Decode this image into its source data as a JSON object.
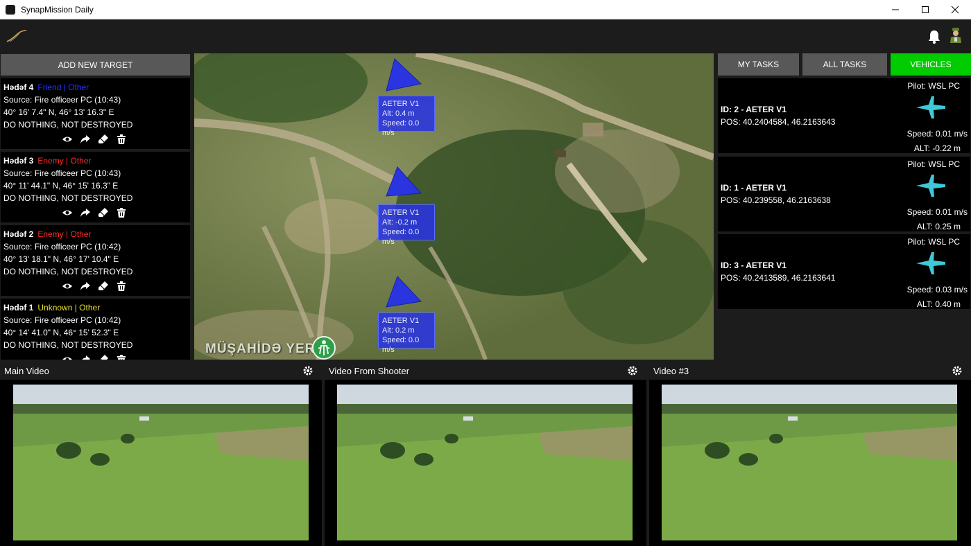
{
  "window": {
    "title": "SynapMission Daily"
  },
  "left_panel": {
    "add_button": "ADD NEW TARGET",
    "targets": [
      {
        "name": "Hədəf 4",
        "type": "Friend | Other",
        "type_color": "#2233ff",
        "source": "Source: Fire officeer PC (10:43)",
        "coords": "40° 16' 7.4\" N, 46° 13' 16.3\" E",
        "status": "DO NOTHING, NOT DESTROYED"
      },
      {
        "name": "Hədəf 3",
        "type": "Enemy | Other",
        "type_color": "#ff2a2a",
        "source": "Source: Fire officeer PC (10:43)",
        "coords": "40° 11' 44.1\" N, 46° 15' 16.3\" E",
        "status": "DO NOTHING, NOT DESTROYED"
      },
      {
        "name": "Hədəf 2",
        "type": "Enemy | Other",
        "type_color": "#ff2a2a",
        "source": "Source: Fire officeer PC (10:42)",
        "coords": "40° 13' 18.1\" N, 46° 17' 10.4\" E",
        "status": "DO NOTHING, NOT DESTROYED"
      },
      {
        "name": "Hədəf 1",
        "type": "Unknown | Other",
        "type_color": "#e8e22a",
        "source": "Source: Fire officeer PC (10:42)",
        "coords": "40° 14' 41.0\" N, 46° 15' 52.3\" E",
        "status": "DO NOTHING, NOT DESTROYED"
      }
    ],
    "action_icons": [
      "eye-icon",
      "share-icon",
      "eraser-icon",
      "trash-icon"
    ]
  },
  "map": {
    "observer_label": "MÜŞAHİDƏ YERİ",
    "drones": [
      {
        "name": "AETER V1",
        "alt": "Alt: 0.4 m",
        "speed": "Speed: 0.0 m/s"
      },
      {
        "name": "AETER V1",
        "alt": "Alt: -0.2 m",
        "speed": "Speed: 0.0 m/s"
      },
      {
        "name": "AETER V1",
        "alt": "Alt: 0.2 m",
        "speed": "Speed: 0.0 m/s"
      }
    ],
    "drone_color": "#2a35e0"
  },
  "right_panel": {
    "tabs": [
      {
        "label": "MY TASKS",
        "active": false
      },
      {
        "label": "ALL TASKS",
        "active": false
      },
      {
        "label": "VEHICLES",
        "active": true
      }
    ],
    "active_color": "#00cc00",
    "vehicles": [
      {
        "pilot": "Pilot: WSL PC",
        "id": "ID: 2 - AETER V1",
        "pos": "POS: 40.2404584, 46.2163643",
        "speed": "Speed: 0.01 m/s",
        "alt": "ALT: -0.22 m"
      },
      {
        "pilot": "Pilot: WSL PC",
        "id": "ID: 1 - AETER V1",
        "pos": "POS: 40.239558, 46.2163638",
        "speed": "Speed: 0.01 m/s",
        "alt": "ALT: 0.25 m"
      },
      {
        "pilot": "Pilot: WSL PC",
        "id": "ID: 3 - AETER V1",
        "pos": "POS: 40.2413589, 46.2163641",
        "speed": "Speed: 0.03 m/s",
        "alt": "ALT: 0.40 m"
      }
    ],
    "plane_color": "#3ec8d8"
  },
  "videos": [
    {
      "title": "Main Video"
    },
    {
      "title": "Video From Shooter"
    },
    {
      "title": "Video #3"
    }
  ]
}
